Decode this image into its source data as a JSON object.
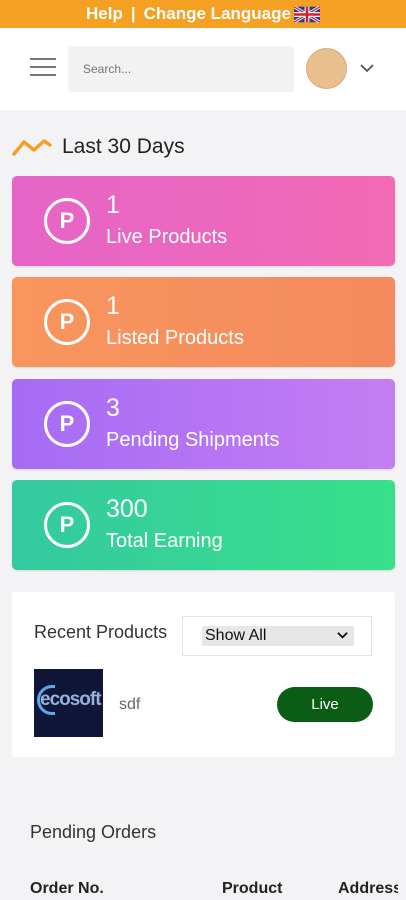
{
  "topbar": {
    "help": "Help",
    "separator": "|",
    "language": "Change Language"
  },
  "header": {
    "search_placeholder": "Search..."
  },
  "period": {
    "label": "Last 30 Days"
  },
  "stats": [
    {
      "value": "1",
      "label": "Live Products",
      "icon": "P"
    },
    {
      "value": "1",
      "label": "Listed Products",
      "icon": "P"
    },
    {
      "value": "3",
      "label": "Pending Shipments",
      "icon": "P"
    },
    {
      "value": "300",
      "label": "Total Earning",
      "icon": "P"
    }
  ],
  "recent": {
    "title": "Recent Products",
    "filter_selected": "Show All",
    "product": {
      "name": "sdf",
      "status": "Live",
      "thumb_text": "ecosoft"
    }
  },
  "pending": {
    "title": "Pending Orders",
    "columns": [
      "Order No.",
      "Product",
      "Address"
    ]
  },
  "colors": {
    "accent": "#f4a022",
    "live": "#0b5c14"
  }
}
